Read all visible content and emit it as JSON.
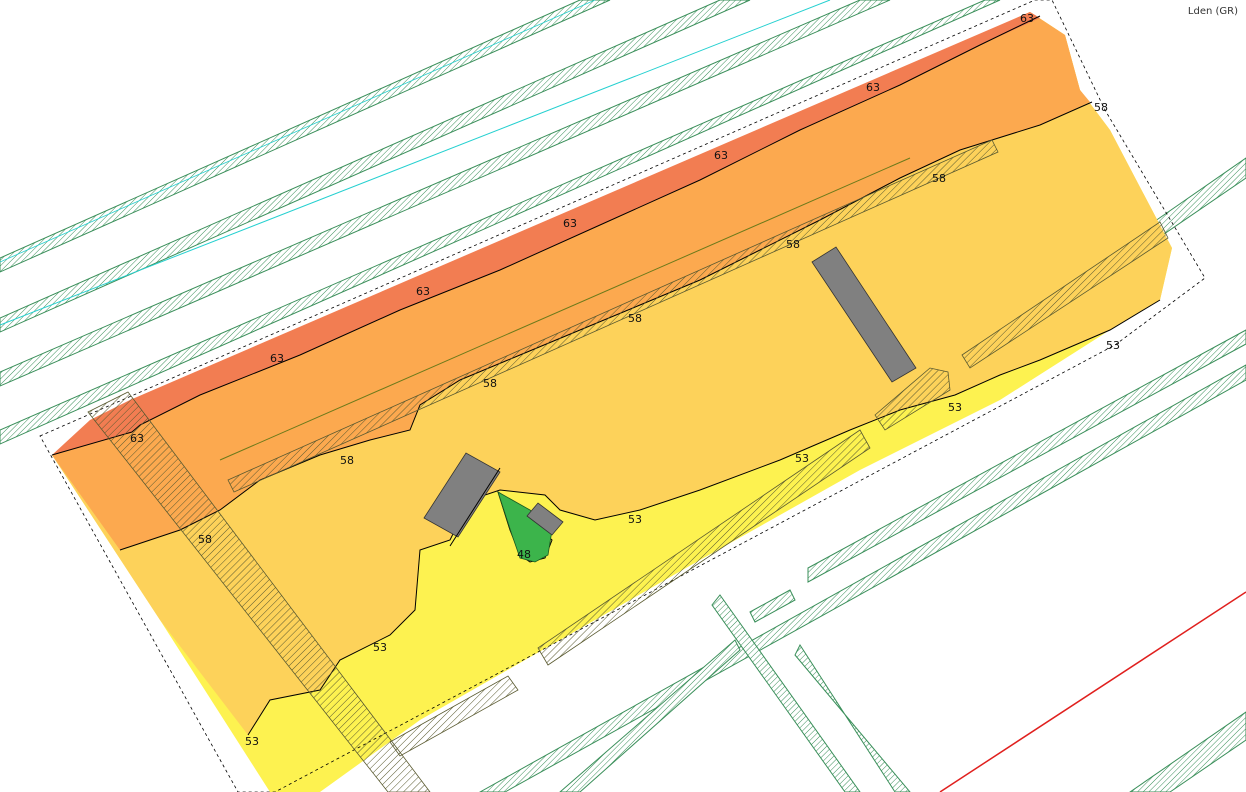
{
  "map": {
    "title": "Lden (GR)",
    "colors": {
      "zone_63_plus": "#f27d52",
      "zone_58_63": "#fca94f",
      "zone_53_58": "#fdd25a",
      "zone_48_53": "#fdf250",
      "zone_below_48": "#3cb44b",
      "building": "#808080",
      "contour": "#000000",
      "hatch_green": "#2e8b57",
      "hatch_dark": "#4a4a2a",
      "cyan_line": "#25d0d0",
      "red_line": "#e0201e"
    },
    "contour_labels": [
      "63",
      "63",
      "63",
      "63",
      "63",
      "63",
      "63",
      "58",
      "58",
      "58",
      "58",
      "58",
      "58",
      "58",
      "53",
      "53",
      "53",
      "53",
      "53",
      "53",
      "48"
    ]
  }
}
